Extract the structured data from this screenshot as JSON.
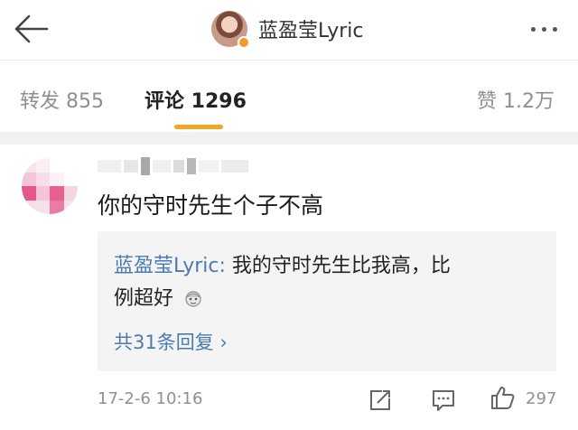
{
  "header": {
    "title": "蓝盈莹Lyric",
    "back_icon": "arrow-left-icon",
    "more_icon": "more-dots-icon",
    "verified_color": "#f59a23"
  },
  "tabs": {
    "repost_label": "转发 855",
    "comments_label": "评论 1296",
    "likes_label": "赞 1.2万",
    "active": "comments",
    "accent_color": "#f5a623"
  },
  "comment": {
    "text": "你的守时先生个子不高",
    "timestamp": "17-2-6 10:16",
    "like_count": "297",
    "reply": {
      "author": "蓝盈莹Lyric:",
      "text_line1": " 我的守时先生比我高，比",
      "text_line2": "例超好",
      "emoji": "emoji-face-icon",
      "reply_count": "共31条回复 ›",
      "link_color": "#4a7bb5"
    }
  }
}
